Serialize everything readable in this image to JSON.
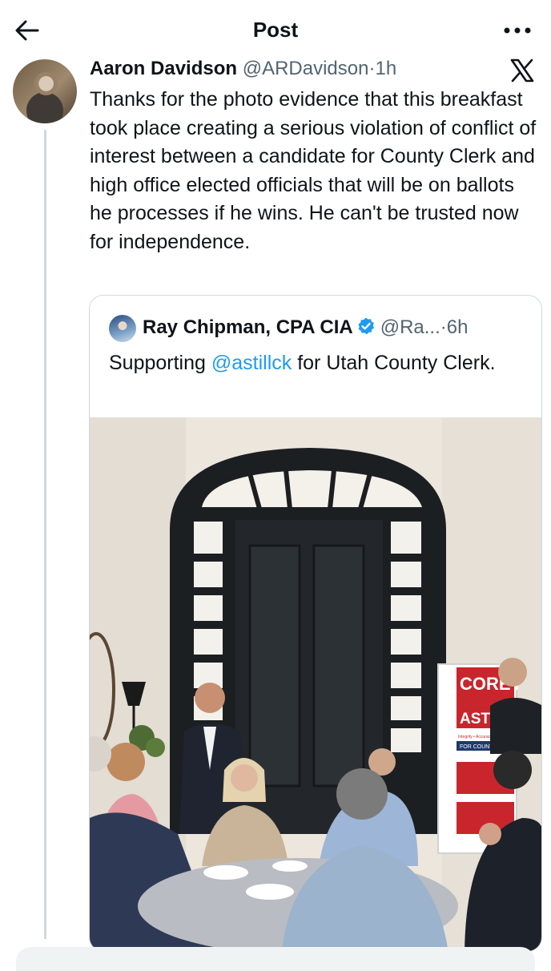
{
  "header": {
    "title": "Post",
    "back_icon": "arrow-left-icon",
    "more_icon": "more-horizontal-icon"
  },
  "post": {
    "author_name": "Aaron Davidson",
    "author_handle": "@ARDavidson",
    "separator": "·",
    "time": "1h",
    "platform_icon": "x-logo-icon",
    "text": "Thanks for the photo evidence that this breakfast took place creating a serious violation of conflict of interest between a candidate for County Clerk and high office elected officials that will be on ballots he processes if he wins. He can't be trusted now for independence."
  },
  "quoted_post": {
    "author_name": "Ray Chipman, CPA CIA",
    "author_handle": "@Ra...",
    "separator": "·",
    "time": "6h",
    "verified_icon": "verified-badge-icon",
    "text_before": "Supporting ",
    "mention": "@astillck",
    "text_after": " for Utah County Clerk.",
    "photo": {
      "sign_text_1": "COREY",
      "sign_text_2": "ASTILL",
      "sign_tagline": "Integrity • Accuracy • Accountability",
      "sign_footer": "FOR COUNTY CLERK"
    }
  },
  "colors": {
    "text": "#0f1419",
    "secondary": "#536471",
    "link": "#1d9bf0",
    "border": "#cfd9de",
    "sign_red": "#c8262c"
  }
}
